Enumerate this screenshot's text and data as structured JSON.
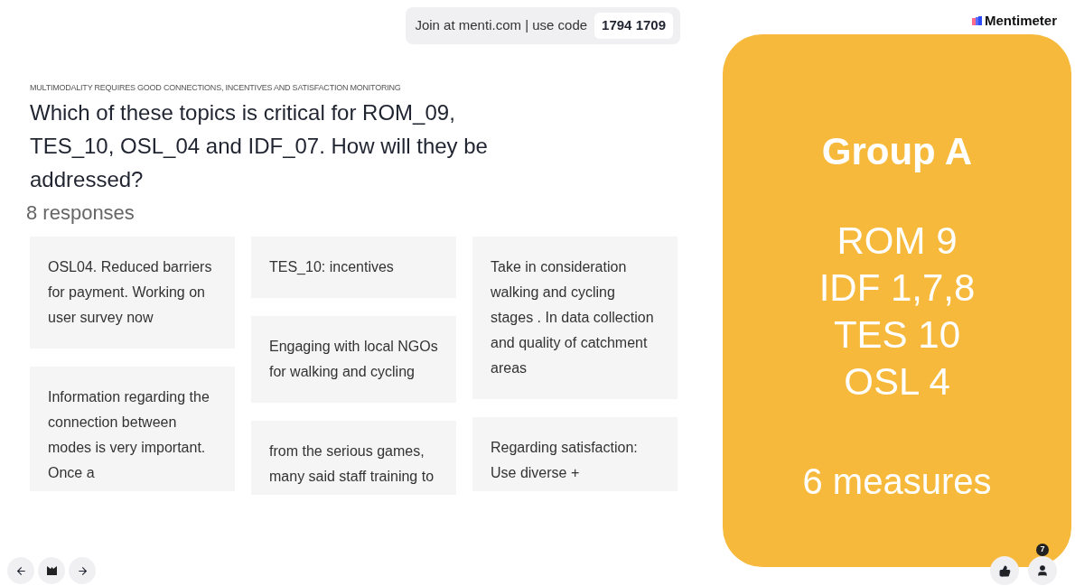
{
  "join_bar": {
    "text": "Join at menti.com | use code",
    "code": "1794 1709"
  },
  "brand": {
    "name": "Mentimeter"
  },
  "slide": {
    "subtitle": "MULTIMODALITY REQUIRES GOOD CONNECTIONS, INCENTIVES AND SATISFACTION MONITORING",
    "question": "Which of these topics is critical for ROM_09, TES_10, OSL_04 and IDF_07. How will they be addressed?",
    "response_count": "8 responses",
    "columns": [
      [
        {
          "text": "OSL04. Reduced barriers for payment. Working on user survey now",
          "cut": false
        },
        {
          "text": "Information regarding the connection between modes is very important. Once a",
          "cut": true
        }
      ],
      [
        {
          "text": "TES_10: incentives",
          "cut": false
        },
        {
          "text": "Engaging with local NGOs for walking and cycling",
          "cut": false
        },
        {
          "text": "from the serious games, many said staff training to",
          "cut": true
        }
      ],
      [
        {
          "text": "Take in consideration walking and cycling stages . In data collection and quality of catchment areas",
          "cut": false
        },
        {
          "text": "Regarding satisfaction: Use diverse +",
          "cut": true
        }
      ]
    ]
  },
  "group_panel": {
    "title": "Group A",
    "lines": [
      "ROM 9",
      "IDF 1,7,8",
      "TES 10",
      "OSL 4"
    ],
    "footer": "6 measures"
  },
  "audience_badge": "7"
}
